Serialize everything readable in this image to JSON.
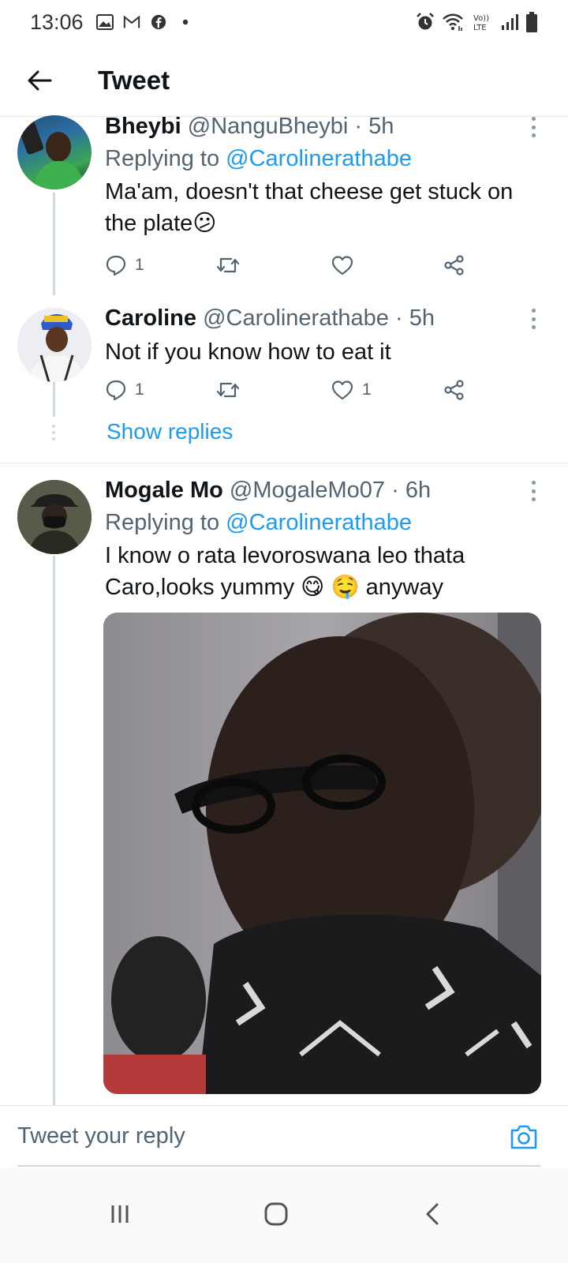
{
  "status_bar": {
    "time": "13:06",
    "left_icons": [
      "gallery-icon",
      "gmail-icon",
      "facebook-icon",
      "dot-icon"
    ],
    "right_icons": [
      "alarm-icon",
      "wifi-icon",
      "volte-icon",
      "signal-icon",
      "battery-icon"
    ],
    "volte_label": "Vo))\nLTE"
  },
  "header": {
    "title": "Tweet"
  },
  "tweets": [
    {
      "name": "Bheybi",
      "handle": "@NanguBheybi",
      "time": "5h",
      "replying_label": "Replying to",
      "replying_to": "@Carolinerathabe",
      "text": "Ma'am, doesn't that cheese get stuck on the plate😕",
      "reply_count": "1",
      "retweet_count": "",
      "like_count": ""
    },
    {
      "name": "Caroline",
      "handle": "@Carolinerathabe",
      "time": "5h",
      "text": "Not if you know how to eat it",
      "reply_count": "1",
      "retweet_count": "",
      "like_count": "1",
      "show_replies": "Show replies"
    },
    {
      "name": "Mogale Mo",
      "handle": "@MogaleMo07",
      "time": "6h",
      "replying_label": "Replying to",
      "replying_to": "@Carolinerathabe",
      "text": "I know o rata levoroswana leo thata Caro,looks yummy 😋 🤤 anyway",
      "reply_count": "",
      "retweet_count": "",
      "like_count": ""
    }
  ],
  "composer": {
    "placeholder": "Tweet your reply"
  },
  "colors": {
    "accent": "#1d9bf0",
    "text_primary": "#0f1419",
    "text_secondary": "#536471",
    "divider": "#e4e6e8",
    "thread_line": "#cfd9de"
  }
}
